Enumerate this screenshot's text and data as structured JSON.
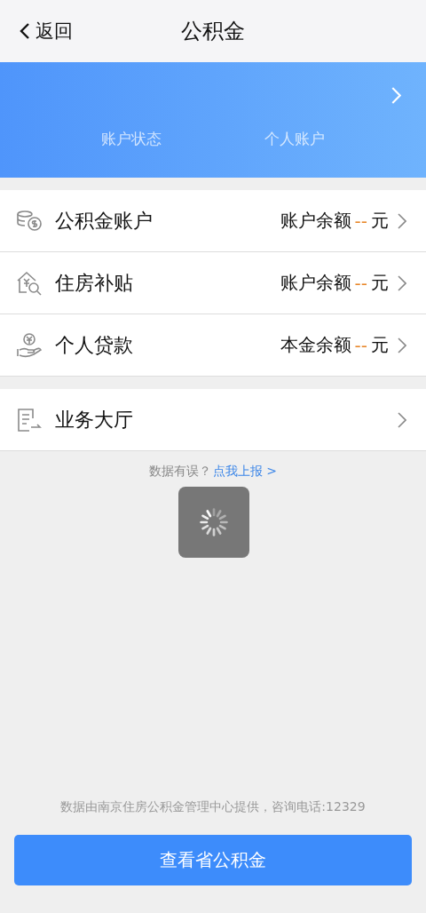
{
  "header": {
    "back_label": "返回",
    "title": "公积金"
  },
  "banner": {
    "labels": [
      "账户状态",
      "个人账户"
    ]
  },
  "accounts": [
    {
      "label": "公积金账户",
      "value_label": "账户余额",
      "value": "--",
      "unit": "元"
    },
    {
      "label": "住房补贴",
      "value_label": "账户余额",
      "value": "--",
      "unit": "元"
    },
    {
      "label": "个人贷款",
      "value_label": "本金余额",
      "value": "--",
      "unit": "元"
    }
  ],
  "services": [
    {
      "label": "业务大厅"
    }
  ],
  "report": {
    "text": "数据有误？",
    "link": "点我上报 >"
  },
  "loading": true,
  "footer_note": "数据由南京住房公积金管理中心提供，咨询电话:12329",
  "primary_button": "查看省公积金"
}
